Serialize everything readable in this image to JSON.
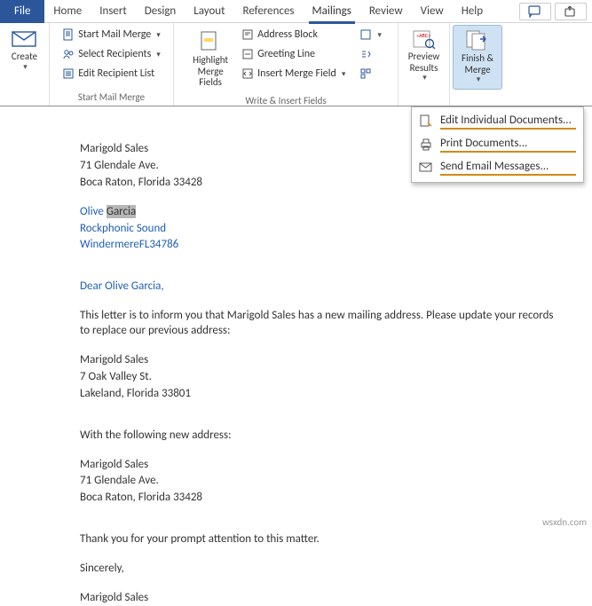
{
  "tabs": {
    "file": "File",
    "home": "Home",
    "insert": "Insert",
    "design": "Design",
    "layout": "Layout",
    "references": "References",
    "mailings": "Mailings",
    "review": "Review",
    "view": "View",
    "help": "Help"
  },
  "ribbon": {
    "create": "Create",
    "start_mail_merge": "Start Mail Merge",
    "select_recipients": "Select Recipients",
    "edit_recipient_list": "Edit Recipient List",
    "group_start": "Start Mail Merge",
    "highlight": "Highlight Merge Fields",
    "address_block": "Address Block",
    "greeting_line": "Greeting Line",
    "insert_merge_field": "Insert Merge Field",
    "group_write": "Write & Insert Fields",
    "preview": "Preview Results",
    "finish": "Finish & Merge"
  },
  "menu": {
    "edit_docs": "Edit Individual Documents...",
    "print_docs": "Print Documents...",
    "email_msgs": "Send Email Messages..."
  },
  "document": {
    "sender_name": "Marigold Sales",
    "sender_addr1": "71 Glendale Ave.",
    "sender_addr2": "Boca Raton, Florida 33428",
    "recip_first": "Olive",
    "recip_last": "Garcia",
    "recip_company": "Rockphonic Sound",
    "recip_cityzip": "WindermereFL34786",
    "greeting": "Dear Olive Garcia,",
    "body1": "This letter is to inform you that Marigold Sales has a new mailing address. Please update your records to replace our previous address:",
    "old_name": "Marigold Sales",
    "old_addr1": "7 Oak Valley St.",
    "old_addr2": "Lakeland, Florida 33801",
    "body2": "With the following new address:",
    "new_name": "Marigold Sales",
    "new_addr1": "71 Glendale Ave.",
    "new_addr2": "Boca Raton, Florida 33428",
    "body3": "Thank you for your prompt attention to this matter.",
    "closing": "Sincerely,",
    "sig": "Marigold Sales"
  },
  "watermark": "wsxdn.com"
}
